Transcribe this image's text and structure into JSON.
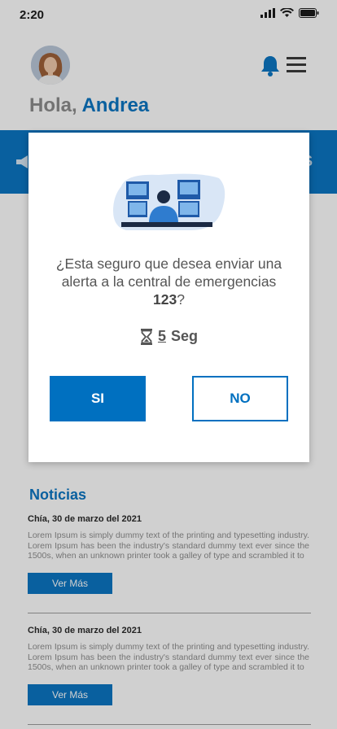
{
  "status_bar": {
    "time": "2:20"
  },
  "header": {
    "greeting_prefix": "Hola,",
    "user_name": "Andrea",
    "icons": [
      "avatar",
      "bell-icon",
      "menu-icon"
    ]
  },
  "strip": {
    "right_text": "S"
  },
  "news": {
    "title": "Noticias",
    "items": [
      {
        "date": "Chía, 30 de marzo del 2021",
        "text": "Lorem Ipsum is simply dummy text of the printing and typesetting industry. Lorem Ipsum has been the industry's standard dummy text ever since the 1500s, when an unknown printer took a galley of type and scrambled it to",
        "button": "Ver Más"
      },
      {
        "date": "Chía, 30 de marzo del 2021",
        "text": "Lorem Ipsum is simply dummy text of the printing and typesetting industry. Lorem Ipsum has been the industry's standard dummy text ever since the 1500s, when an unknown printer took a galley of type and scrambled it to",
        "button": "Ver Más"
      }
    ]
  },
  "modal": {
    "question_part1": "¿Esta seguro que desea enviar una alerta a la central de emergencias",
    "question_number": "123",
    "question_end": "?",
    "timer_value": "5",
    "timer_unit": "Seg",
    "yes_label": "SI",
    "no_label": "NO"
  },
  "colors": {
    "primary": "#0070c0",
    "overlay": "rgba(40,40,40,0.22)"
  }
}
